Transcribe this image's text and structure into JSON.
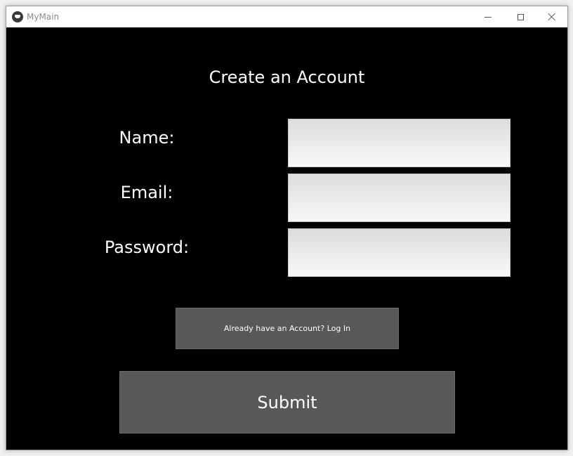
{
  "window": {
    "title": "MyMain"
  },
  "form": {
    "heading": "Create an Account",
    "fields": [
      {
        "label": "Name:",
        "value": "",
        "placeholder": ""
      },
      {
        "label": "Email:",
        "value": "",
        "placeholder": ""
      },
      {
        "label": "Password:",
        "value": "",
        "placeholder": ""
      }
    ],
    "login_label": "Already have an Account? Log In",
    "submit_label": "Submit"
  },
  "colors": {
    "background": "#000000",
    "button": "#585858",
    "text": "#ffffff"
  }
}
